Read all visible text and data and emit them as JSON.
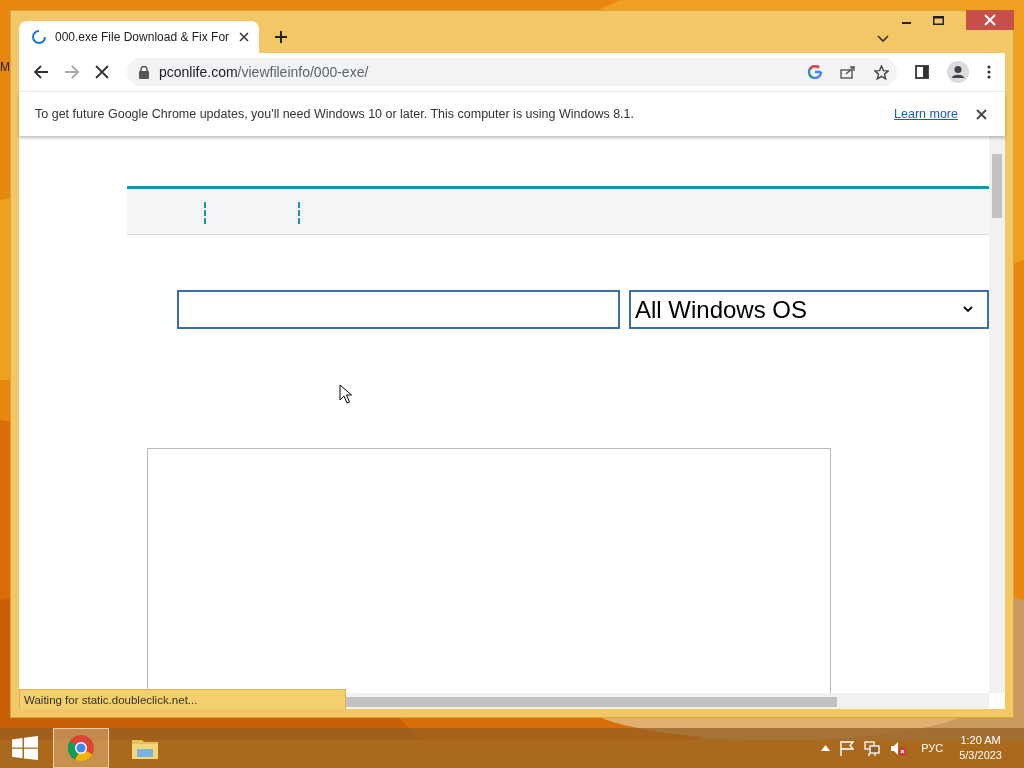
{
  "desktop": {
    "icon_label": "M"
  },
  "browser": {
    "tab": {
      "title": "000.exe File Download & Fix For",
      "loading": true
    },
    "address": {
      "domain": "pconlife.com",
      "path": "/viewfileinfo/000-exe/"
    },
    "infobar": {
      "message": "To get future Google Chrome updates, you'll need Windows 10 or later. This computer is using Windows 8.1.",
      "link": "Learn more"
    },
    "status": "Waiting for static.doubleclick.net..."
  },
  "page": {
    "os_select": {
      "value": "All Windows OS"
    }
  },
  "taskbar": {
    "apps": [
      {
        "kind": "chrome",
        "selected": true
      },
      {
        "kind": "explorer",
        "selected": false
      }
    ],
    "language": "РУС",
    "time": "1:20 AM",
    "date": "5/3/2023"
  }
}
